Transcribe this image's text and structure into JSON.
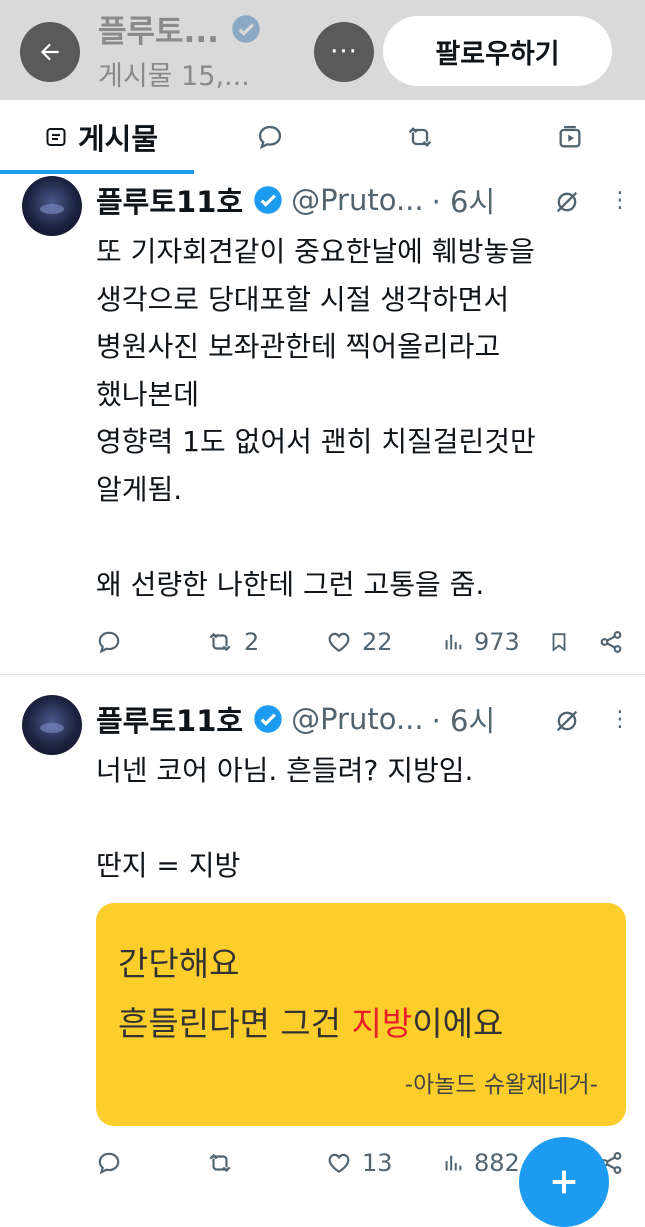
{
  "header": {
    "title": "플루토...",
    "subtitle": "게시물 15,...",
    "follow_label": "팔로우하기"
  },
  "tabs": {
    "posts_label": "게시물"
  },
  "tweets": [
    {
      "name": "플루토11호",
      "handle": "@Pruto...",
      "time": "· 6시",
      "text": "또 기자회견같이 중요한날에 훼방놓을\n생각으로 당대포할 시절 생각하면서\n병원사진 보좌관한테 찍어올리라고\n했나본데\n영향력 1도 없어서 괜히 치질걸린것만\n알게됨.\n\n왜 선량한 나한테 그런 고통을 줌.",
      "retweets": "2",
      "likes": "22",
      "views": "973"
    },
    {
      "name": "플루토11호",
      "handle": "@Pruto...",
      "time": "· 6시",
      "text": "너넨 코어 아님. 흔들려? 지방임.\n\n딴지 = 지방",
      "retweets": "",
      "likes": "13",
      "views": "882",
      "media": {
        "line1": "간단해요",
        "line2_pre": "흔들린다면 그건 ",
        "line2_red": "지방",
        "line2_post": "이에요",
        "credit": "-아놀드 슈왈제네거-"
      }
    }
  ],
  "colors": {
    "accent": "#1d9bf0",
    "header_bg": "#d9d9d9",
    "media_bg": "#fcce2b",
    "highlight_red": "#e8202a"
  },
  "icons": [
    "back-arrow-icon",
    "more-icon",
    "verified-badge-icon",
    "posts-icon",
    "reply-icon",
    "retweet-icon",
    "media-icon",
    "grok-slash-icon",
    "like-icon",
    "views-icon",
    "bookmark-icon",
    "share-icon",
    "plus-icon"
  ]
}
